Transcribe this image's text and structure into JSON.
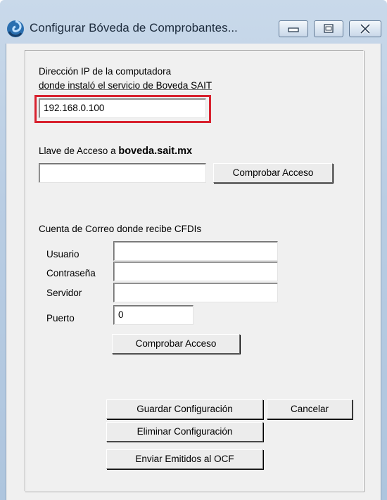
{
  "window": {
    "title": "Configurar Bóveda de Comprobantes...",
    "icon": "app-swirl-icon"
  },
  "ip_section": {
    "label_line1": "Dirección IP de la computadora",
    "label_line2": "donde instaló el servicio de Boveda SAIT",
    "ip_value": "192.168.0.100",
    "highlight_color": "#d8222f"
  },
  "access_key": {
    "label_prefix": "Llave de Acceso a",
    "label_domain": "boveda.sait.mx",
    "key_value": "",
    "check_button": "Comprobar Acceso"
  },
  "email": {
    "heading": "Cuenta de Correo donde recibe CFDIs",
    "user_label": "Usuario",
    "user_value": "",
    "password_label": "Contraseña",
    "password_value": "",
    "server_label": "Servidor",
    "server_value": "",
    "port_label": "Puerto",
    "port_value": "0",
    "check_button": "Comprobar Acceso"
  },
  "actions": {
    "save": "Guardar Configuración",
    "cancel": "Cancelar",
    "delete": "Eliminar Configuración",
    "send": "Enviar Emitidos al OCF"
  }
}
